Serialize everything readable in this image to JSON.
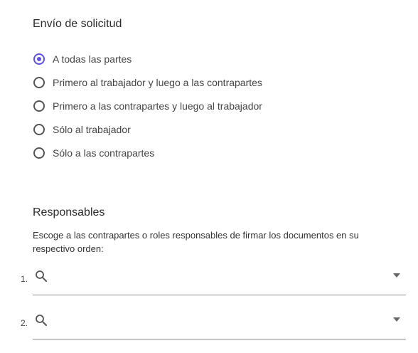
{
  "envio": {
    "title": "Envío de solicitud",
    "options": [
      {
        "label": "A todas las partes",
        "checked": true
      },
      {
        "label": "Primero al trabajador y luego a las contrapartes",
        "checked": false
      },
      {
        "label": "Primero a las contrapartes y luego al trabajador",
        "checked": false
      },
      {
        "label": "Sólo al trabajador",
        "checked": false
      },
      {
        "label": "Sólo a las contrapartes",
        "checked": false
      }
    ]
  },
  "responsables": {
    "title": "Responsables",
    "description": "Escoge a las contrapartes o roles responsables de firmar los documentos en su respectivo orden:",
    "rows": [
      {
        "number": "1.",
        "value": ""
      },
      {
        "number": "2.",
        "value": ""
      }
    ]
  },
  "colors": {
    "accent": "#5b50e8"
  },
  "icons": [
    "search-icon",
    "chevron-down-icon"
  ]
}
